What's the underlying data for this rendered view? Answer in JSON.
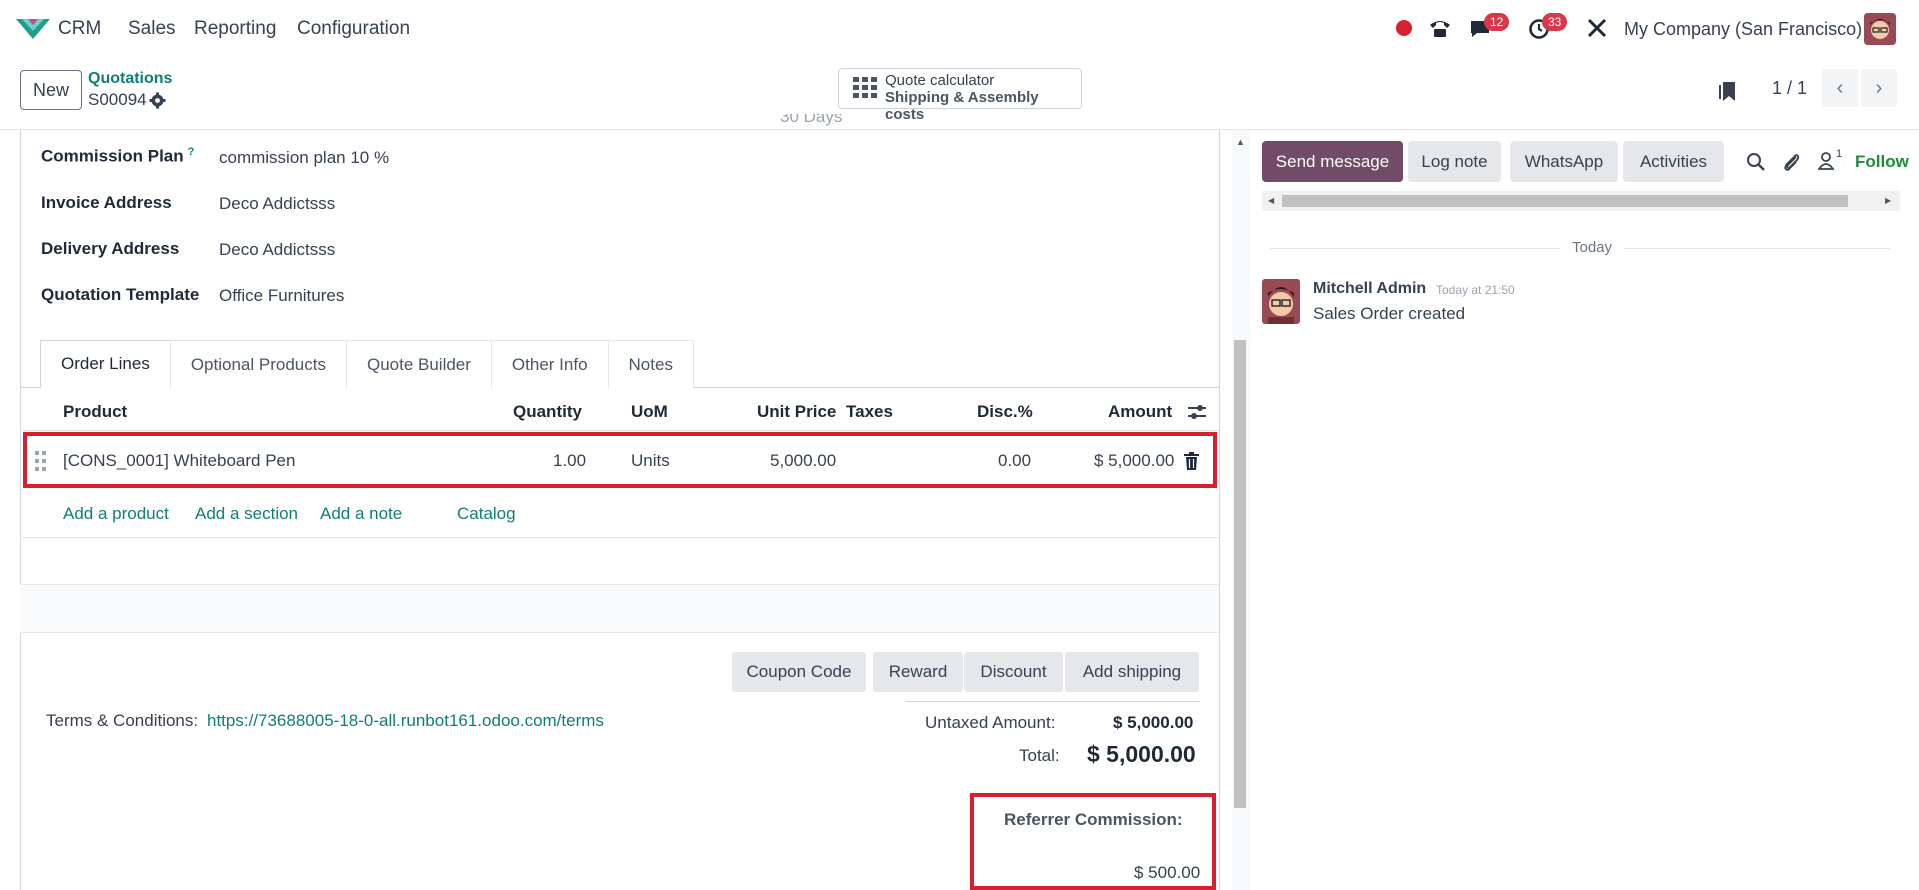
{
  "topnav": {
    "app_name": "CRM",
    "menus": [
      "Sales",
      "Reporting",
      "Configuration"
    ],
    "messages_badge": "12",
    "activities_badge": "33",
    "company": "My Company (San Francisco)"
  },
  "control": {
    "new_label": "New",
    "breadcrumb": "Quotations",
    "record_name": "S00094",
    "quote_calc_line1": "Quote calculator",
    "quote_calc_line2": "Shipping & Assembly costs",
    "pager": "1 / 1"
  },
  "form": {
    "partial_top_text": "30 Days",
    "fields": [
      {
        "label": "Commission Plan",
        "value": "commission plan 10 %",
        "help": "?"
      },
      {
        "label": "Invoice Address",
        "value": "Deco Addictsss"
      },
      {
        "label": "Delivery Address",
        "value": "Deco Addictsss"
      },
      {
        "label": "Quotation Template",
        "value": "Office Furnitures"
      }
    ],
    "tabs": [
      "Order Lines",
      "Optional Products",
      "Quote Builder",
      "Other Info",
      "Notes"
    ],
    "columns": {
      "product": "Product",
      "quantity": "Quantity",
      "uom": "UoM",
      "unit_price": "Unit Price",
      "taxes": "Taxes",
      "disc": "Disc.%",
      "amount": "Amount"
    },
    "line": {
      "product": "[CONS_0001] Whiteboard Pen",
      "quantity": "1.00",
      "uom": "Units",
      "unit_price": "5,000.00",
      "taxes": "",
      "disc": "0.00",
      "amount": "$ 5,000.00"
    },
    "add_links": [
      "Add a product",
      "Add a section",
      "Add a note",
      "Catalog"
    ],
    "action_buttons": [
      "Coupon Code",
      "Reward",
      "Discount",
      "Add shipping"
    ],
    "terms_label": "Terms & Conditions:",
    "terms_url": "https://73688005-18-0-all.runbot161.odoo.com/terms",
    "untaxed_label": "Untaxed Amount:",
    "untaxed_value": "$ 5,000.00",
    "total_label": "Total:",
    "total_value": "$ 5,000.00",
    "commission_label": "Referrer Commission:",
    "commission_value": "$ 500.00"
  },
  "chatter": {
    "send_message": "Send message",
    "log_note": "Log note",
    "whatsapp": "WhatsApp",
    "activities": "Activities",
    "followers_count": "1",
    "follow_label": "Follow",
    "date_separator": "Today",
    "message": {
      "author": "Mitchell Admin",
      "time": "Today at 21:50",
      "body": "Sales Order created"
    }
  },
  "colors": {
    "brand_primary": "#714b67",
    "link": "#0d7f78",
    "highlight": "#d6222f",
    "badge": "#d8394a"
  }
}
